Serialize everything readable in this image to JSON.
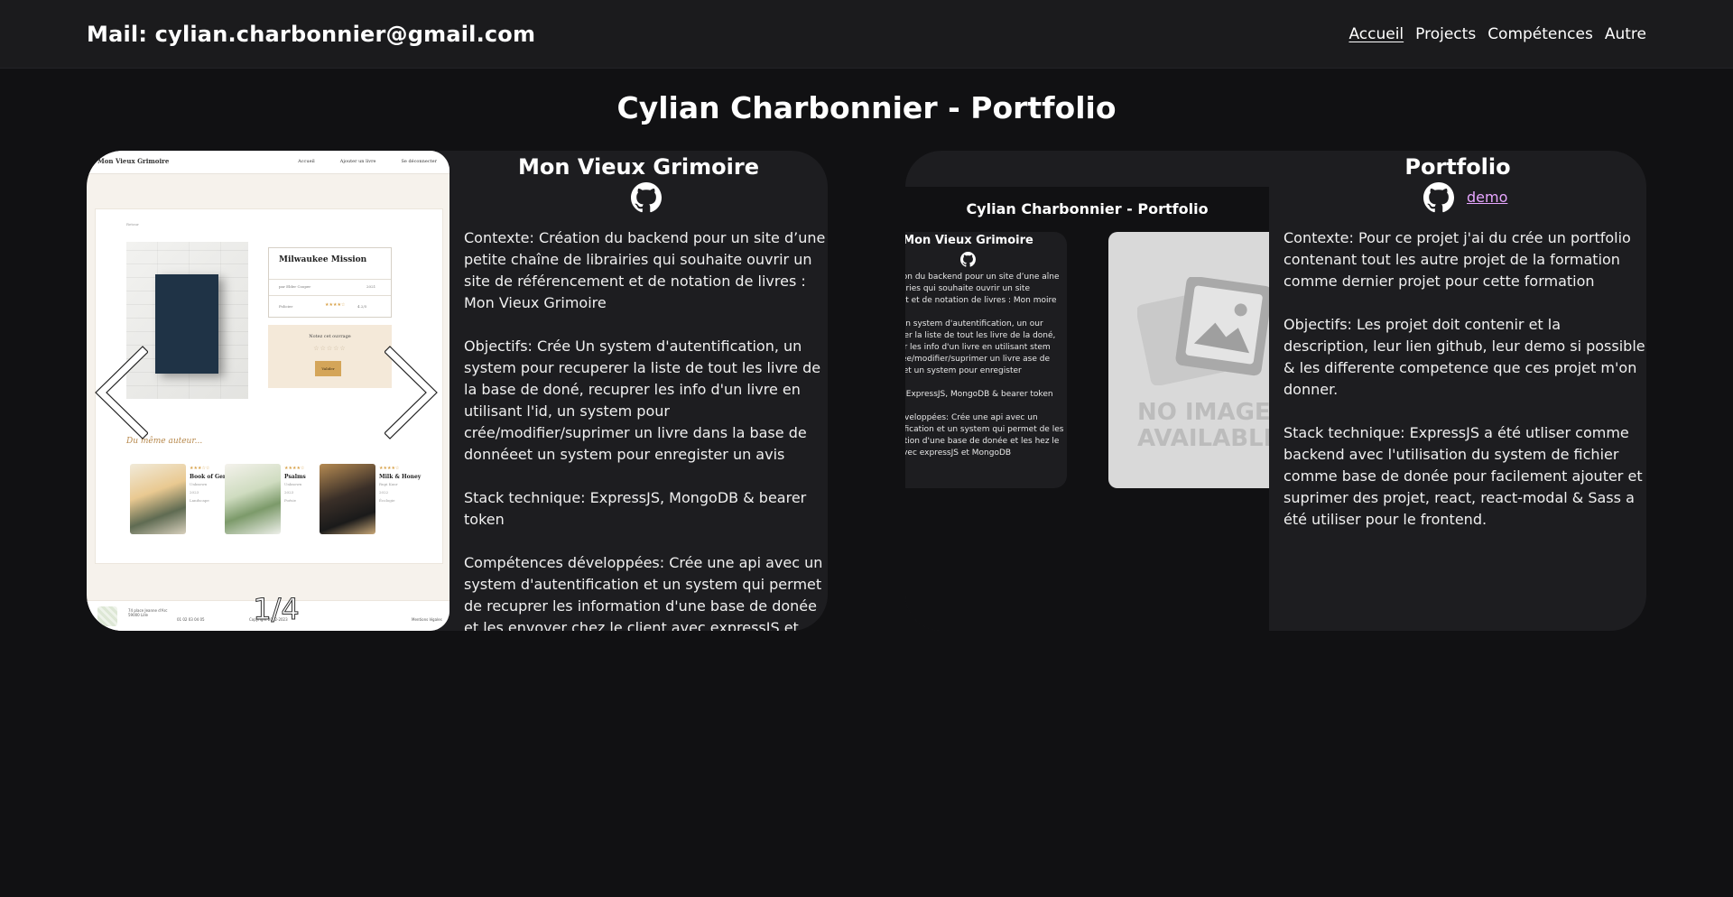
{
  "header": {
    "mail": "Mail: cylian.charbonnier@gmail.com",
    "nav": [
      "Accueil",
      "Projects",
      "Compétences",
      "Autre"
    ],
    "active_nav": "Accueil"
  },
  "page_title": "Cylian Charbonnier - Portfolio",
  "projects": [
    {
      "title": "Mon Vieux Grimoire",
      "links": {
        "github_icon": "github-icon"
      },
      "carousel": {
        "counter": "1/4",
        "screenshot": {
          "logo": "Mon Vieux Grimoire",
          "nav": [
            "Accueil",
            "Ajouter un livre",
            "Se déconnecter"
          ],
          "crumb": "Retour",
          "book_title": "Milwaukee Mission",
          "book_author": "par Elder Cooper",
          "book_year": "2021",
          "book_genre": "Policier",
          "book_rating": "4.2/5",
          "rate_title": "Notez cet ouvrage",
          "rate_button": "Valider",
          "same_author": "Du même auteur...",
          "recommendations": [
            {
              "title": "Book of Genesis",
              "author": "Unknown",
              "year": "2023",
              "genre": "Landscape"
            },
            {
              "title": "Psalms",
              "author": "Unknown",
              "year": "2023",
              "genre": "Poésie"
            },
            {
              "title": "Milk & Honey",
              "author": "Rupi Kaur",
              "year": "2022",
              "genre": "Écologie"
            }
          ],
          "footer_address": "74 place Jeanne d'Arc 59000 Lille",
          "footer_phone": "01 02 03 04 05",
          "footer_copyright": "Copyright 2022-2023",
          "footer_legal": "Mentions légales"
        }
      },
      "paragraphs": [
        "Contexte: Création du backend pour un site d’une petite chaîne de librairies qui souhaite ouvrir un site de référencement et de notation de livres : Mon Vieux Grimoire",
        "Objectifs: Crée Un system d'autentification, un system pour recuperer la liste de tout les livre de la base de doné, recuprer les info d'un livre en utilisant l'id, un system pour crée/modifier/suprimer un livre dans la base de donnéeet un system pour enregister un avis",
        "Stack technique: ExpressJS, MongoDB & bearer token",
        "Compétences développées: Crée une api avec un system d'autentification et un system qui permet de recuprer les information d'une base de donée et les envoyer chez le client avec expressJS et MongoDB"
      ]
    },
    {
      "title": "Portfolio",
      "links": {
        "github_icon": "github-icon",
        "demo": "demo"
      },
      "preview": {
        "title": "Cylian Charbonnier - Portfolio",
        "card_title": "Mon Vieux Grimoire",
        "card_paragraphs": [
          ": Création du backend pour un site d’une aîne de librairies qui souhaite ouvrir un site ncement et de notation de livres : Mon moire",
          ": Crée Un system d'autentification, un our recuperer la liste de tout les livre de la doné, recuprer les info d'un livre en utilisant stem pour crée/modifier/suprimer un livre ase de donnéeet un system pour enregister",
          "hnique: ExpressJS, MongoDB & bearer token",
          "nces développées: Crée une api avec un 'autentification et un system qui permet de les information d'une base de donée et les hez le client avec expressJS et MongoDB"
        ],
        "no_image": [
          "NO IMAGE",
          "AVAILABLE"
        ]
      },
      "paragraphs": [
        "Contexte: Pour ce projet j'ai du crée un portfolio contenant tout les autre projet de la formation comme dernier projet pour cette formation",
        "Objectifs: Les projet doit contenir et la description, leur lien github, leur demo si possible & les differente competence que ces projet m'on donner.",
        "Stack technique: ExpressJS a été utliser comme backend avec l'utilisation du system de fichier comme base de donée pour facilement ajouter et suprimer des projet, react, react-modal & Sass a été utiliser pour le frontend."
      ]
    }
  ],
  "colors": {
    "background": "#111113",
    "header": "#1b1b1d",
    "card": "#1d1d20",
    "link": "#e7a6ff"
  }
}
